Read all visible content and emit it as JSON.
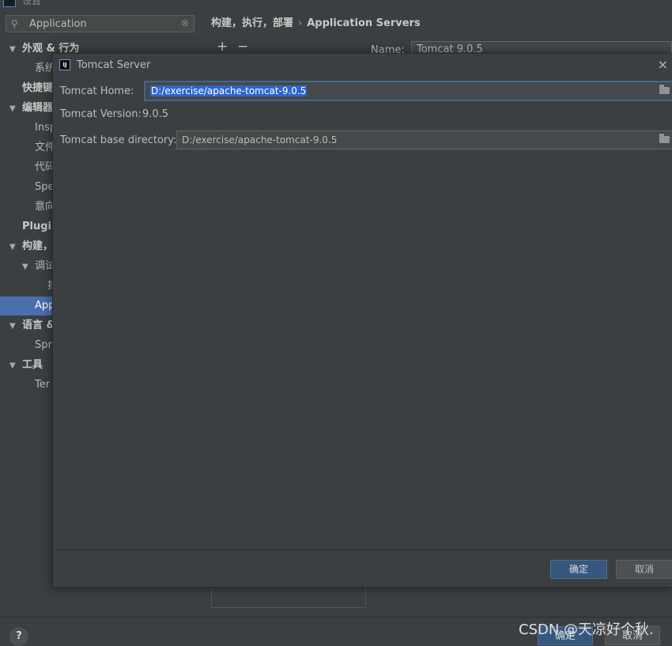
{
  "sidebar": {
    "window_title": "设置",
    "search": {
      "value": "Application",
      "icon": "search-icon"
    },
    "items": [
      {
        "label": "外观 & 行为",
        "bold": true,
        "expanded": true
      },
      {
        "label": "系统",
        "bold": false
      },
      {
        "label": "快捷键",
        "bold": true
      },
      {
        "label": "编辑器",
        "bold": true,
        "expanded": true
      },
      {
        "label": "Insp",
        "bold": false
      },
      {
        "label": "文件",
        "bold": false
      },
      {
        "label": "代码",
        "bold": false
      },
      {
        "label": "Spe",
        "bold": false
      },
      {
        "label": "意向",
        "bold": false
      },
      {
        "label": "Plugin",
        "bold": true
      },
      {
        "label": "构建，",
        "bold": true,
        "expanded": true
      },
      {
        "label": "调试",
        "bold": false,
        "expanded": true
      },
      {
        "label": "抹",
        "bold": false
      },
      {
        "label": "App",
        "bold": false,
        "selected": true
      },
      {
        "label": "语言 &",
        "bold": true,
        "expanded": true
      },
      {
        "label": "Spr",
        "bold": false
      },
      {
        "label": "工具",
        "bold": true,
        "expanded": true
      },
      {
        "label": "Ter",
        "bold": false
      }
    ]
  },
  "content": {
    "breadcrumb": {
      "parent": "构建，执行，部署",
      "current": "Application Servers"
    },
    "toolbar": {
      "add": "+",
      "remove": "−"
    },
    "name_label": "Name:",
    "name_value": "Tomcat 9.0.5"
  },
  "dialog": {
    "title": "Tomcat Server",
    "home_label": "Tomcat Home:",
    "home_value": "D:/exercise/apache-tomcat-9.0.5",
    "version_label": "Tomcat Version:",
    "version_value": "9.0.5",
    "base_label": "Tomcat base directory:",
    "base_value": "D:/exercise/apache-tomcat-9.0.5",
    "ok": "确定",
    "cancel": "取消",
    "close": "×"
  },
  "bottom": {
    "help": "?",
    "ok": "确定",
    "cancel": "取消",
    "watermark": "CSDN @天凉好个秋."
  },
  "colors": {
    "background": "#3c3f41",
    "selection": "#4b6eaf",
    "primary_button": "#365880",
    "text_selection": "#2f65ca"
  }
}
